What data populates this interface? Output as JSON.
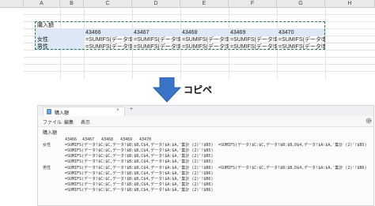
{
  "spreadsheet": {
    "columns": [
      "A",
      "B",
      "C",
      "D",
      "E",
      "F",
      "G",
      "H"
    ],
    "title_cell": "購入額",
    "header_values": [
      "43466",
      "43467",
      "43468",
      "43469",
      "43470"
    ],
    "rows": [
      {
        "label": "女性",
        "formula": "=SUMIFS(データ!$C:$"
      },
      {
        "label": "男性",
        "formula": "=SUMIFS(データ!$C:$"
      }
    ]
  },
  "arrow": {
    "label": "コピペ"
  },
  "notepad": {
    "tab_title": "購入額",
    "close_glyph": "×",
    "new_tab_glyph": "+",
    "menus": [
      "ファイル",
      "編集",
      "表示"
    ],
    "settings_icon": "gear-icon",
    "content_title": "購入額",
    "header_values": [
      "43466",
      "43467",
      "43468",
      "43469",
      "43470"
    ],
    "female_label": "女性",
    "male_label": "男性",
    "female_lines": [
      "=SUMIFS(データ!$C:$C,データ!$B:$B,C$4,データ!$A:$A,'集計 (2)'!$B5)",
      "=SUMIFS(データ!$C:$C,データ!$B:$B,C$4,データ!$A:$A,'集計 (2)'!$B5)",
      "=SUMIFS(データ!$C:$C,データ!$B:$B,C$4,データ!$A:$A,'集計 (2)'!$B5)",
      "=SUMIFS(データ!$C:$C,データ!$B:$B,C$4,データ!$A:$A,'集計 (2)'!$B5)"
    ],
    "female_right": "=SUMIFS(データ!$C:$C,データ!$B:$B,D$4,データ!$A:$A,'集計 (2)'!$B5)",
    "male_lines": [
      "=SUMIFS(データ!$C:$C,データ!$B:$B,C$4,データ!$A:$A,'集計 (2)'!$B6)",
      "=SUMIFS(データ!$C:$C,データ!$B:$B,C$4,データ!$A:$A,'集計 (2)'!$B6)",
      "=SUMIFS(データ!$C:$C,データ!$B:$B,C$4,データ!$A:$A,'集計 (2)'!$B6)",
      "=SUMIFS(データ!$C:$C,データ!$B:$B,C$4,データ!$A:$A,'集計 (2)'!$B6)",
      "=SUMIFS(データ!$C:$C,データ!$B:$B,C$4,データ!$A:$A,'集計 (2)'!$B6)"
    ],
    "male_right": "=SUMIFS(データ!$C:$C,データ!$B:$B,D$4,データ!$A:$A,'集計 (2)'!$B6)"
  }
}
